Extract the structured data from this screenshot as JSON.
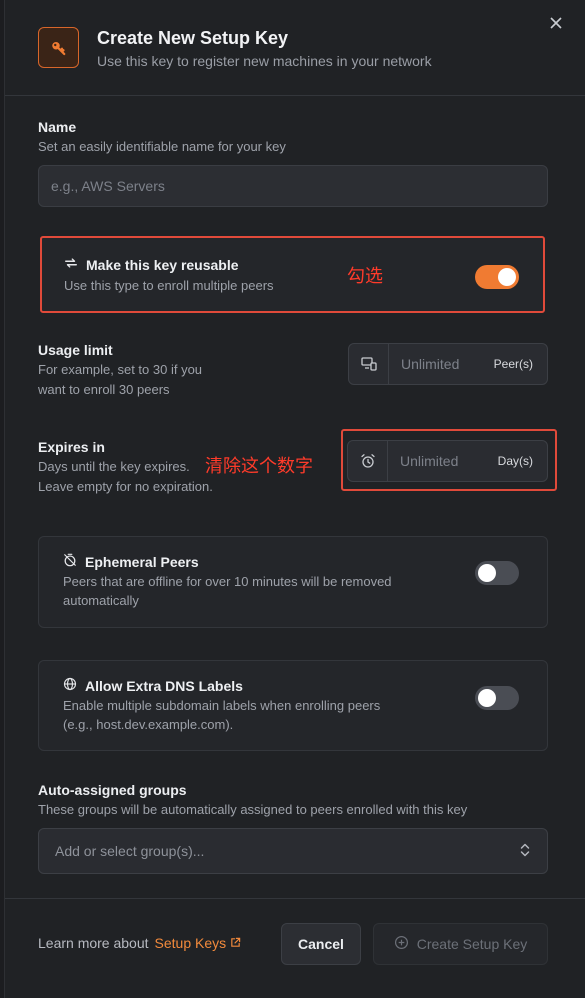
{
  "header": {
    "title": "Create New Setup Key",
    "subtitle": "Use this key to register new machines in your network"
  },
  "name_field": {
    "label": "Name",
    "help": "Set an easily identifiable name for your key",
    "placeholder": "e.g., AWS Servers"
  },
  "reusable": {
    "title": "Make this key reusable",
    "help": "Use this type to enroll multiple peers",
    "enabled": true,
    "annotation": "勾选"
  },
  "usage_limit": {
    "label": "Usage limit",
    "help_line1": "For example, set to 30 if you",
    "help_line2": "want to enroll 30 peers",
    "placeholder": "Unlimited",
    "unit": "Peer(s)"
  },
  "expires": {
    "label": "Expires in",
    "help_line1": "Days until the key expires.",
    "help_line2": "Leave empty for no expiration.",
    "placeholder": "Unlimited",
    "unit": "Day(s)",
    "annotation": "清除这个数字"
  },
  "ephemeral": {
    "title": "Ephemeral Peers",
    "help_line1": "Peers that are offline for over 10 minutes will be removed",
    "help_line2": "automatically",
    "enabled": false
  },
  "dns_labels": {
    "title": "Allow Extra DNS Labels",
    "help_line1": "Enable multiple subdomain labels when enrolling peers",
    "help_line2": "(e.g., host.dev.example.com).",
    "enabled": false
  },
  "groups": {
    "label": "Auto-assigned groups",
    "help": "These groups will be automatically assigned to peers enrolled with this key",
    "placeholder": "Add or select group(s)..."
  },
  "footer": {
    "learn_more": "Learn more about",
    "link_text": "Setup Keys",
    "cancel_label": "Cancel",
    "create_label": "Create Setup Key"
  },
  "colors": {
    "accent": "#f07b32",
    "annotation": "#e04a3a"
  }
}
